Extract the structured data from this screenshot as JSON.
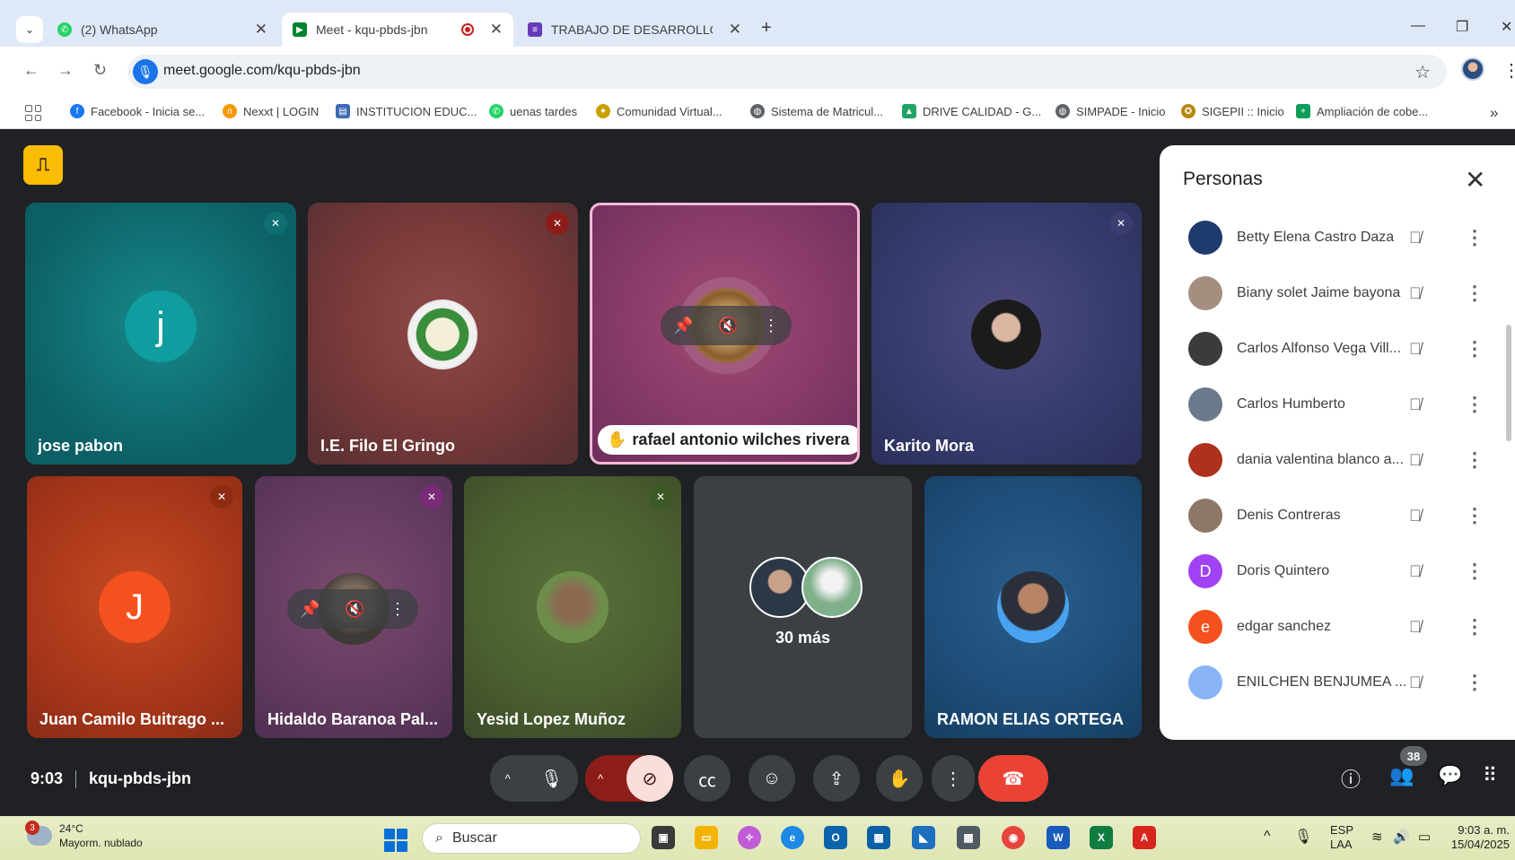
{
  "browser": {
    "tabs": [
      {
        "title": "(2) WhatsApp",
        "favicon": "whatsapp-icon"
      },
      {
        "title": "Meet - kqu-pbds-jbn",
        "favicon": "meet-icon",
        "recording": true
      },
      {
        "title": "TRABAJO DE DESARROLLO INS",
        "favicon": "forms-icon"
      }
    ],
    "url": "meet.google.com/kqu-pbds-jbn",
    "bookmarks": [
      {
        "label": "Facebook - Inicia se...",
        "color": "#1877f2"
      },
      {
        "label": "Nexxt | LOGIN",
        "color": "#f29900"
      },
      {
        "label": "INSTITUCION EDUC...",
        "color": "#3c6bb4"
      },
      {
        "label": "uenas tardes",
        "color": "#25d366"
      },
      {
        "label": "Comunidad Virtual...",
        "color": "#c8a000"
      },
      {
        "label": "Sistema de Matricul...",
        "color": "#5f6368"
      },
      {
        "label": "DRIVE CALIDAD - G...",
        "color": "#1fa463"
      },
      {
        "label": "SIMPADE - Inicio",
        "color": "#5f6368"
      },
      {
        "label": "SIGEPII :: Inicio",
        "color": "#b8860b"
      },
      {
        "label": "Ampliación de cobe...",
        "color": "#0f9d58"
      }
    ],
    "more_bookmarks": "»"
  },
  "meet": {
    "tiles": [
      {
        "name": "jose pabon",
        "avatar_letter": "j",
        "muted": true
      },
      {
        "name": "I.E. Filo El Gringo",
        "muted": true
      },
      {
        "name": "rafael antonio wilches rivera",
        "hand_raised": true,
        "active_speaker": true
      },
      {
        "name": "Karito Mora",
        "muted": true
      },
      {
        "name": "Juan Camilo Buitrago ...",
        "avatar_letter": "J",
        "muted": true
      },
      {
        "name": "Hidaldo Baranoa Pal...",
        "muted": true
      },
      {
        "name": "Yesid Lopez Muñoz",
        "muted": true
      },
      {
        "name": "30 más"
      },
      {
        "name": "RAMON ELIAS ORTEGA"
      }
    ],
    "meeting_time": "9:03",
    "meeting_code": "kqu-pbds-jbn",
    "people_count": "38"
  },
  "panel": {
    "title": "Personas",
    "participants": [
      {
        "name": "Betty Elena Castro Daza",
        "avatar": "",
        "color": "#1f3b6e"
      },
      {
        "name": "Biany solet Jaime bayona",
        "avatar": "",
        "color": "#a58d80"
      },
      {
        "name": "Carlos Alfonso Vega Vill...",
        "avatar": "",
        "color": "#3b3b3b"
      },
      {
        "name": "Carlos Humberto",
        "avatar": "",
        "color": "#6b7a8a"
      },
      {
        "name": "dania valentina blanco a...",
        "avatar": "",
        "color": "#b0301e"
      },
      {
        "name": "Denis Contreras",
        "avatar": "",
        "color": "#8d7766"
      },
      {
        "name": "Doris Quintero",
        "avatar": "D",
        "color": "#a142f4"
      },
      {
        "name": "edgar sanchez",
        "avatar": "e",
        "color": "#f4511e"
      },
      {
        "name": "ENILCHEN BENJUMEA ...",
        "avatar": "",
        "color": "#8ab4f8"
      }
    ]
  },
  "taskbar": {
    "weather_temp": "24°C",
    "weather_desc": "Mayorm. nublado",
    "weather_badge": "3",
    "search_placeholder": "Buscar",
    "lang_top": "ESP",
    "lang_bottom": "LAA",
    "clock_time": "9:03 a. m.",
    "clock_date": "15/04/2025"
  }
}
